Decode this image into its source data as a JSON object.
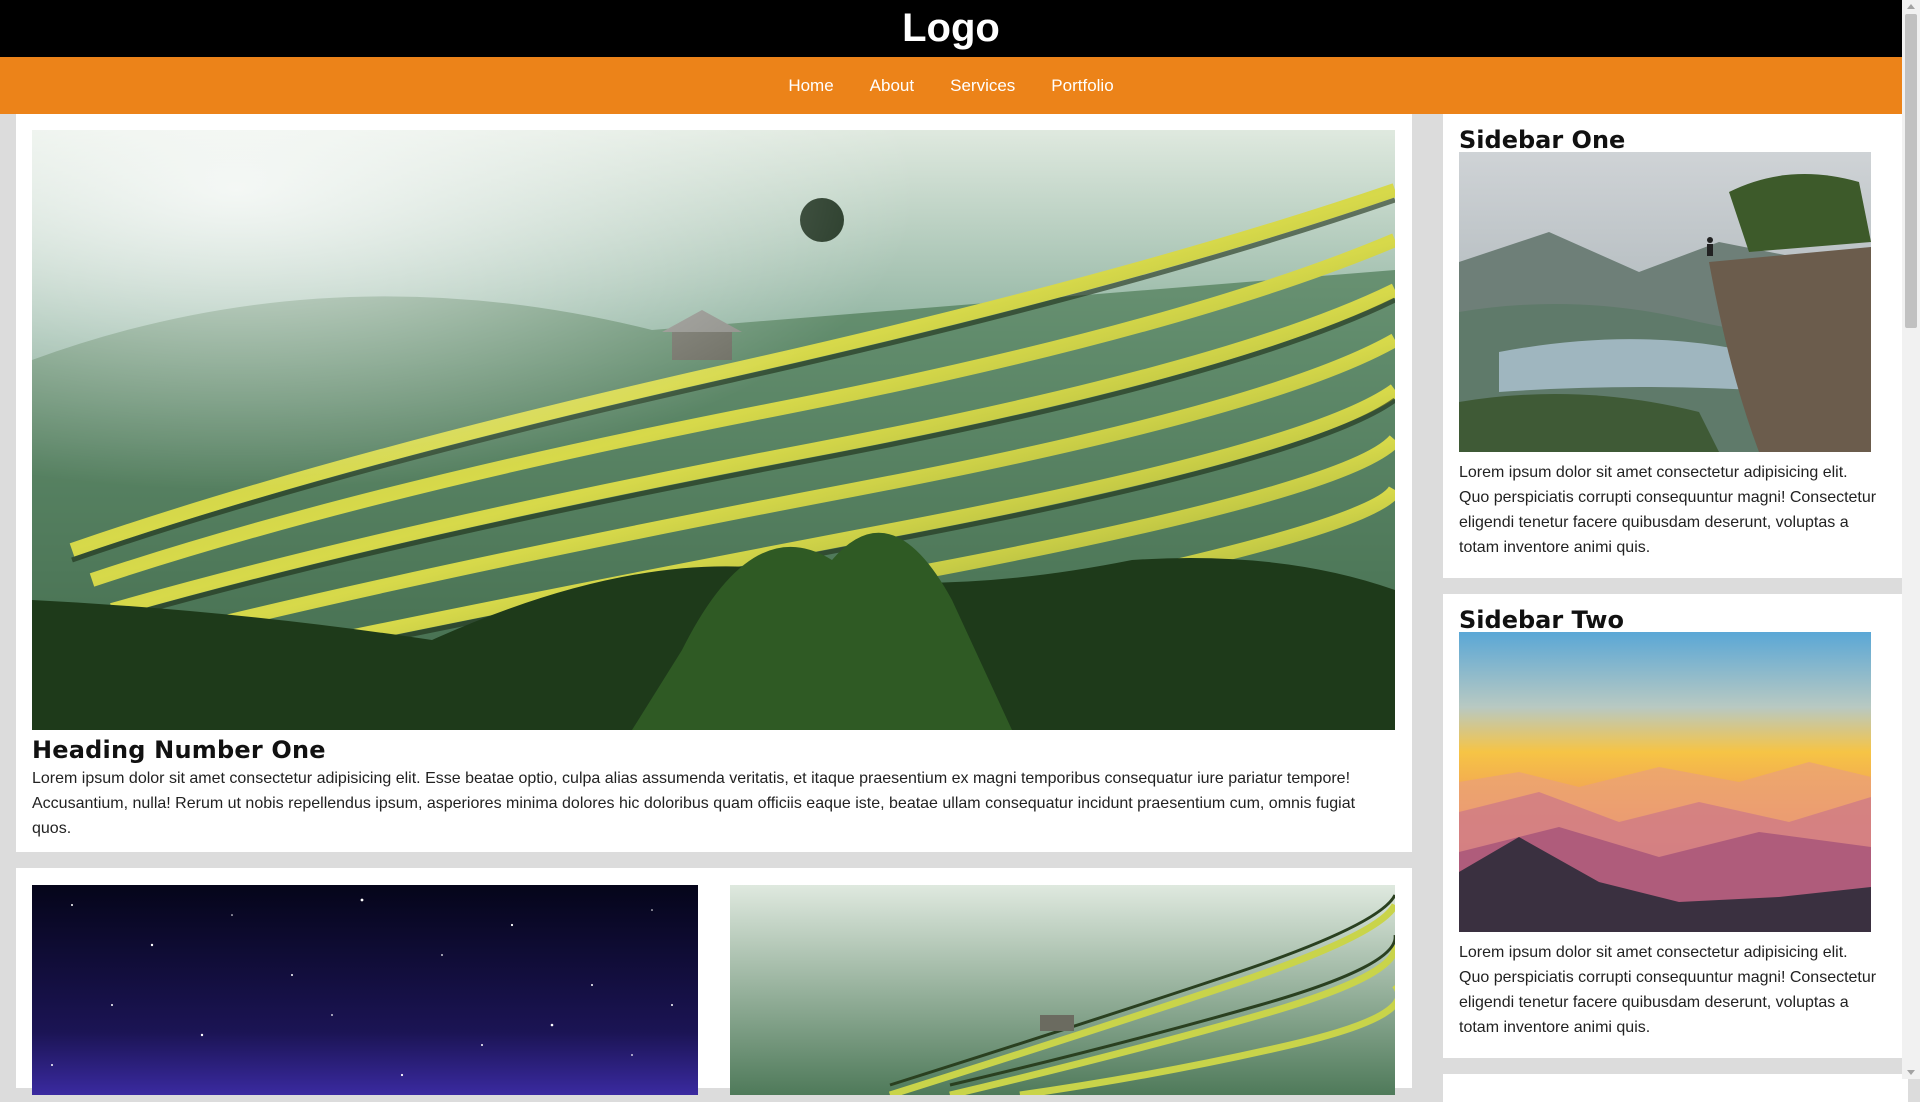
{
  "header": {
    "logo": "Logo"
  },
  "nav": {
    "items": [
      "Home",
      "About",
      "Services",
      "Portfolio"
    ]
  },
  "main": {
    "heading": "Heading Number One",
    "body": "Lorem ipsum dolor sit amet consectetur adipisicing elit. Esse beatae optio, culpa alias assumenda veritatis, et itaque praesentium ex magni temporibus consequatur iure pariatur tempore! Accusantium, nulla! Rerum ut nobis repellendus ipsum, asperiores minima dolores hic doloribus quam officiis eaque iste, beatae ullam consequatur incidunt praesentium cum, omnis fugiat quos."
  },
  "sidebar": {
    "one": {
      "title": "Sidebar One",
      "body": "Lorem ipsum dolor sit amet consectetur adipisicing elit. Quo perspiciatis corrupti consequuntur magni! Consectetur eligendi tenetur facere quibusdam deserunt, voluptas a totam inventore animi quis."
    },
    "two": {
      "title": "Sidebar Two",
      "body": "Lorem ipsum dolor sit amet consectetur adipisicing elit. Quo perspiciatis corrupti consequuntur magni! Consectetur eligendi tenetur facere quibusdam deserunt, voluptas a totam inventore animi quis."
    }
  },
  "images": {
    "main": "rice-terraces-photo",
    "grid_left": "starry-night-sky-photo",
    "grid_right": "rice-terraces-photo",
    "sidebar_one": "fjord-cliff-photo",
    "sidebar_two": "sunset-mountains-photo"
  },
  "colors": {
    "header_bg": "#000000",
    "nav_bg": "#ec8319",
    "page_bg": "#dcdcdc"
  }
}
